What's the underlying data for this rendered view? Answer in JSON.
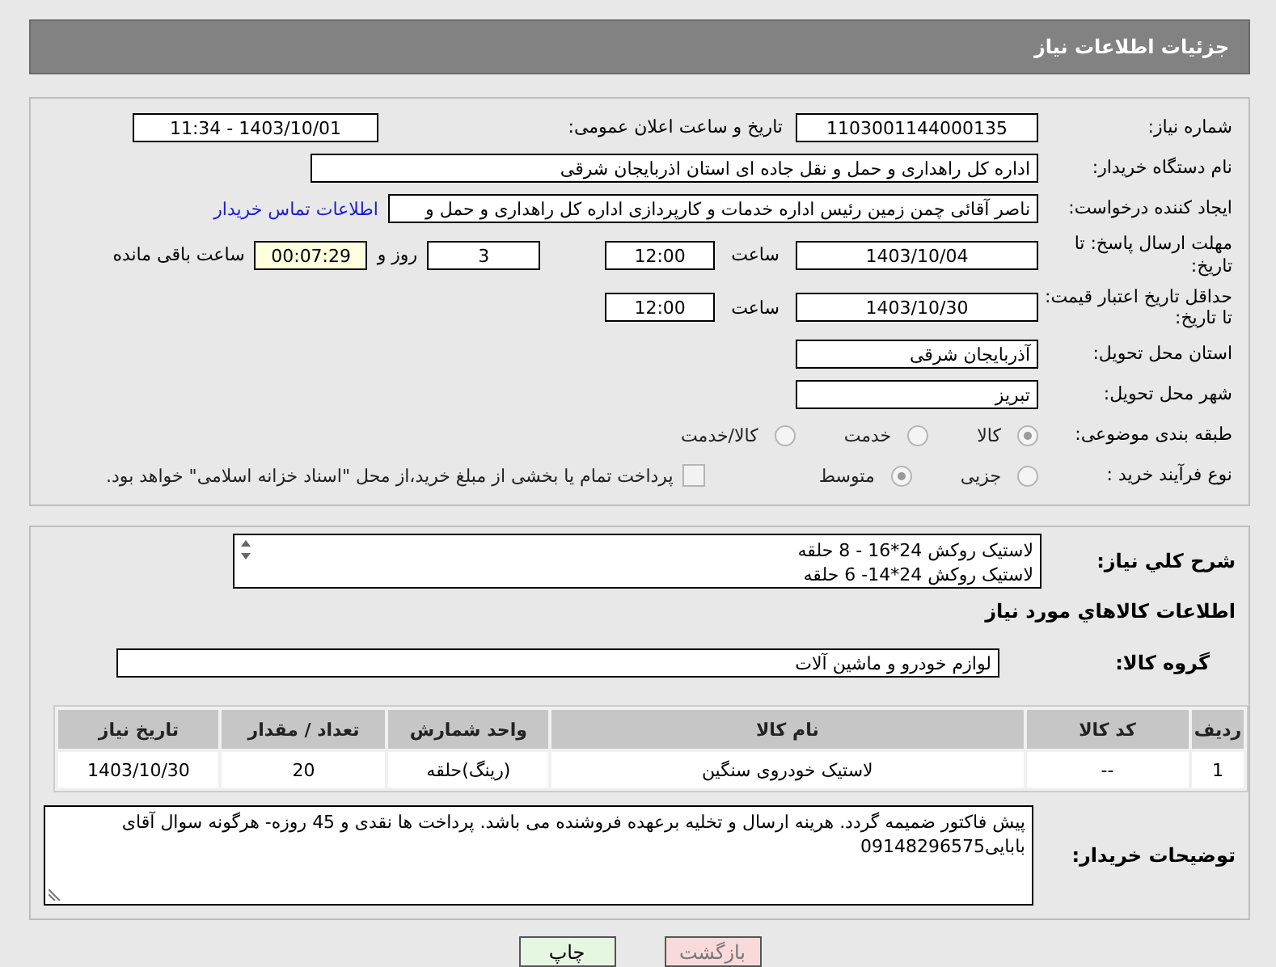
{
  "header": {
    "title": "جزئیات اطلاعات نیاز"
  },
  "need_number": {
    "label": "شماره نیاز:",
    "value": "1103001144000135"
  },
  "announce": {
    "label": "تاریخ و ساعت اعلان عمومی:",
    "value": "1403/10/01 - 11:34"
  },
  "buyer_org": {
    "label": "نام دستگاه خریدار:",
    "value": "اداره کل راهداری و حمل و نقل جاده ای استان اذربایجان شرقی"
  },
  "requester": {
    "label": "ایجاد کننده درخواست:",
    "value": "ناصر آقائی چمن زمین رئیس اداره خدمات و کارپردازی اداره کل راهداری و حمل و",
    "link": "اطلاعات تماس خریدار"
  },
  "deadline": {
    "label": "مهلت ارسال پاسخ: تا تاریخ:",
    "date": "1403/10/04",
    "time_label": "ساعت",
    "time": "12:00",
    "days": "3",
    "days_label": "روز و",
    "remaining": "00:07:29",
    "remaining_label": "ساعت باقی مانده"
  },
  "validity": {
    "label": "حداقل تاریخ اعتبار قیمت: تا تاریخ:",
    "date": "1403/10/30",
    "time_label": "ساعت",
    "time": "12:00"
  },
  "province": {
    "label": "استان محل تحویل:",
    "value": "آذربایجان شرقی"
  },
  "city": {
    "label": "شهر محل تحویل:",
    "value": "تبریز"
  },
  "category": {
    "label": "طبقه بندی موضوعی:",
    "options": [
      {
        "label": "کالا",
        "selected": true
      },
      {
        "label": "خدمت",
        "selected": false
      },
      {
        "label": "کالا/خدمت",
        "selected": false
      }
    ]
  },
  "process": {
    "label": "نوع فرآیند خرید :",
    "options": [
      {
        "label": "جزیی",
        "selected": false
      },
      {
        "label": "متوسط",
        "selected": true
      }
    ],
    "payment": {
      "label": "پرداخت تمام یا بخشی از مبلغ خرید،از محل \"اسناد خزانه اسلامی\" خواهد بود.",
      "checked": false
    }
  },
  "description": {
    "label": "شرح کلي نياز:",
    "lines": [
      "لاستیک روکش 24*16 - 8 حلقه",
      "لاستیک روکش 24*14- 6 حلقه"
    ]
  },
  "goods_title": "اطلاعات کالاهاي مورد نياز",
  "group": {
    "label": "گروه کالا:",
    "value": "لوازم خودرو و ماشین آلات"
  },
  "table": {
    "columns": [
      "ردیف",
      "کد کالا",
      "نام کالا",
      "واحد شمارش",
      "تعداد / مقدار",
      "تاریخ نیاز"
    ],
    "rows": [
      [
        "1",
        "--",
        "لاستیک خودروی سنگین",
        "(رینگ)حلقه",
        "20",
        "1403/10/30"
      ]
    ]
  },
  "notes": {
    "label": "توضیحات خریدار:",
    "value": "پیش فاکتور ضمیمه گردد. هرینه ارسال و تخلیه برعهده فروشنده می باشد. پرداخت ها نقدی و 45 روزه- هرگونه سوال آقای بابایی09148296575"
  },
  "buttons": [
    {
      "label": "بازگشت",
      "kind": "back"
    },
    {
      "label": "چاپ",
      "kind": "print"
    }
  ]
}
